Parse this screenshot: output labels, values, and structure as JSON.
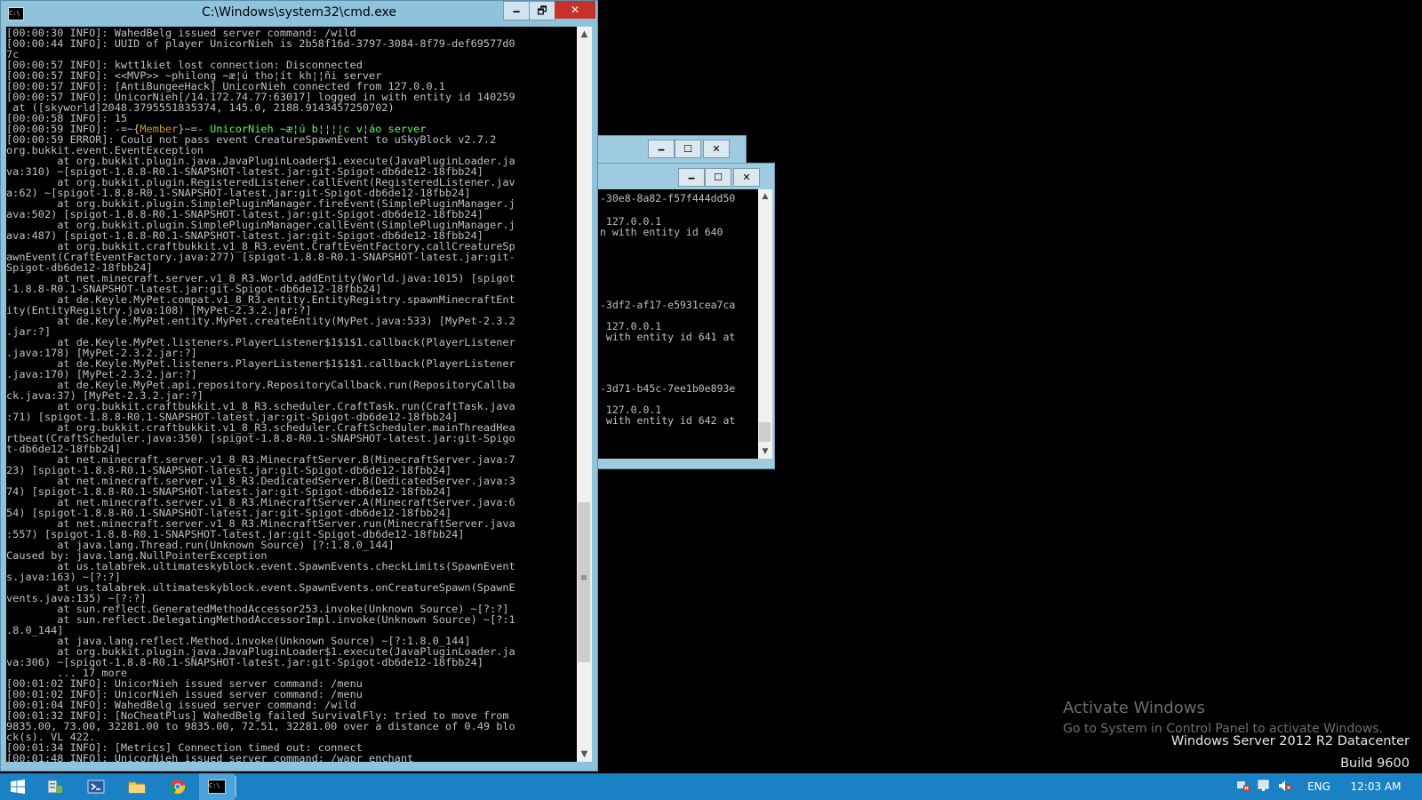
{
  "cmd_window": {
    "title": "C:\\Windows\\system32\\cmd.exe",
    "minimize_label": "🗕",
    "maximize_label": "🗗",
    "close_label": "✕"
  },
  "console_lines": [
    "[00:00:30 INFO]: WahedBelg issued server command: /wild",
    "[00:00:44 INFO]: UUID of player UnicorNieh is 2b58f16d-3797-3084-8f79-def69577d0",
    "7c",
    "[00:00:57 INFO]: kwtt1kiet lost connection: Disconnected",
    "[00:00:57 INFO]: <<MVP>> ~philong ~æ¦ú tho¦ít kh¦¦ñi server",
    "[00:00:57 INFO]: [AntiBungeeHack] UnicorNieh connected from 127.0.0.1",
    "[00:00:57 INFO]: UnicorNieh[/14.172.74.77:63017] logged in with entity id 140259",
    " at ([skyworld]2048.3795551835374, 145.0, 2188.9143457250702)",
    "[00:00:58 INFO]: 15",
    "[00:00:59 INFO]: -=~{Member}~=- UnicorNieh ~æ¦ú b¦¦¦¦c v¦áo server",
    "[00:00:59 ERROR]: Could not pass event CreatureSpawnEvent to uSkyBlock v2.7.2",
    "org.bukkit.event.EventException",
    "        at org.bukkit.plugin.java.JavaPluginLoader$1.execute(JavaPluginLoader.ja",
    "va:310) ~[spigot-1.8.8-R0.1-SNAPSHOT-latest.jar:git-Spigot-db6de12-18fbb24]",
    "        at org.bukkit.plugin.RegisteredListener.callEvent(RegisteredListener.jav",
    "a:62) ~[spigot-1.8.8-R0.1-SNAPSHOT-latest.jar:git-Spigot-db6de12-18fbb24]",
    "        at org.bukkit.plugin.SimplePluginManager.fireEvent(SimplePluginManager.j",
    "ava:502) [spigot-1.8.8-R0.1-SNAPSHOT-latest.jar:git-Spigot-db6de12-18fbb24]",
    "        at org.bukkit.plugin.SimplePluginManager.callEvent(SimplePluginManager.j",
    "ava:487) [spigot-1.8.8-R0.1-SNAPSHOT-latest.jar:git-Spigot-db6de12-18fbb24]",
    "        at org.bukkit.craftbukkit.v1_8_R3.event.CraftEventFactory.callCreatureSp",
    "awnEvent(CraftEventFactory.java:277) [spigot-1.8.8-R0.1-SNAPSHOT-latest.jar:git-",
    "Spigot-db6de12-18fbb24]",
    "        at net.minecraft.server.v1_8_R3.World.addEntity(World.java:1015) [spigot",
    "-1.8.8-R0.1-SNAPSHOT-latest.jar:git-Spigot-db6de12-18fbb24]",
    "        at de.Keyle.MyPet.compat.v1_8_R3.entity.EntityRegistry.spawnMinecraftEnt",
    "ity(EntityRegistry.java:108) [MyPet-2.3.2.jar:?]",
    "        at de.Keyle.MyPet.entity.MyPet.createEntity(MyPet.java:533) [MyPet-2.3.2",
    ".jar:?]",
    "        at de.Keyle.MyPet.listeners.PlayerListener$1$1$1.callback(PlayerListener",
    ".java:178) [MyPet-2.3.2.jar:?]",
    "        at de.Keyle.MyPet.listeners.PlayerListener$1$1$1.callback(PlayerListener",
    ".java:170) [MyPet-2.3.2.jar:?]",
    "        at de.Keyle.MyPet.api.repository.RepositoryCallback.run(RepositoryCallba",
    "ck.java:37) [MyPet-2.3.2.jar:?]",
    "        at org.bukkit.craftbukkit.v1_8_R3.scheduler.CraftTask.run(CraftTask.java",
    ":71) [spigot-1.8.8-R0.1-SNAPSHOT-latest.jar:git-Spigot-db6de12-18fbb24]",
    "        at org.bukkit.craftbukkit.v1_8_R3.scheduler.CraftScheduler.mainThreadHea",
    "rtbeat(CraftScheduler.java:350) [spigot-1.8.8-R0.1-SNAPSHOT-latest.jar:git-Spigo",
    "t-db6de12-18fbb24]",
    "        at net.minecraft.server.v1_8_R3.MinecraftServer.B(MinecraftServer.java:7",
    "23) [spigot-1.8.8-R0.1-SNAPSHOT-latest.jar:git-Spigot-db6de12-18fbb24]",
    "        at net.minecraft.server.v1_8_R3.DedicatedServer.B(DedicatedServer.java:3",
    "74) [spigot-1.8.8-R0.1-SNAPSHOT-latest.jar:git-Spigot-db6de12-18fbb24]",
    "        at net.minecraft.server.v1_8_R3.MinecraftServer.A(MinecraftServer.java:6",
    "54) [spigot-1.8.8-R0.1-SNAPSHOT-latest.jar:git-Spigot-db6de12-18fbb24]",
    "        at net.minecraft.server.v1_8_R3.MinecraftServer.run(MinecraftServer.java",
    ":557) [spigot-1.8.8-R0.1-SNAPSHOT-latest.jar:git-Spigot-db6de12-18fbb24]",
    "        at java.lang.Thread.run(Unknown Source) [?:1.8.0_144]",
    "Caused by: java.lang.NullPointerException",
    "        at us.talabrek.ultimateskyblock.event.SpawnEvents.checkLimits(SpawnEvent",
    "s.java:163) ~[?:?]",
    "        at us.talabrek.ultimateskyblock.event.SpawnEvents.onCreatureSpawn(SpawnE",
    "vents.java:135) ~[?:?]",
    "        at sun.reflect.GeneratedMethodAccessor253.invoke(Unknown Source) ~[?:?]",
    "        at sun.reflect.DelegatingMethodAccessorImpl.invoke(Unknown Source) ~[?:1",
    ".8.0_144]",
    "        at java.lang.reflect.Method.invoke(Unknown Source) ~[?:1.8.0_144]",
    "        at org.bukkit.plugin.java.JavaPluginLoader$1.execute(JavaPluginLoader.ja",
    "va:306) ~[spigot-1.8.8-R0.1-SNAPSHOT-latest.jar:git-Spigot-db6de12-18fbb24]",
    "        ... 17 more",
    "[00:01:02 INFO]: UnicorNieh issued server command: /menu",
    "[00:01:02 INFO]: UnicorNieh issued server command: /menu",
    "[00:01:04 INFO]: WahedBelg issued server command: /wild",
    "[00:01:32 INFO]: [NoCheatPlus] WahedBelg failed SurvivalFly: tried to move from",
    "9835.00, 73.00, 32281.00 to 9835.00, 72.51, 32281.00 over a distance of 0.49 blo",
    "ck(s). VL 422.",
    "[00:01:34 INFO]: [Metrics] Connection timed out: connect",
    "[00:01:48 INFO]: UnicorNieh issued server command: /wapr enchant"
  ],
  "colored_line": {
    "index": 9,
    "prefix": "[00:00:59 INFO]: -=~{",
    "member": "Member",
    "suffix": "}~=- ",
    "rest": "UnicorNieh ~æ¦ú b¦¦¦¦c v¦áo server"
  },
  "bg_window": {
    "lines": [
      "-30e8-8a82-f57f444dd50",
      " 127.0.0.1",
      "n with entity id 640",
      "-3df2-af17-e5931cea7ca",
      " 127.0.0.1",
      " with entity id 641 at",
      "-3d71-b45c-7ee1b0e893e",
      " 127.0.0.1",
      " with entity id 642 at"
    ]
  },
  "watermark": {
    "line1": "Activate Windows",
    "line2": "Go to System in Control Panel to activate Windows.",
    "line3": "Windows Server 2012 R2 Datacenter",
    "line4": "Build 9600"
  },
  "taskbar": {
    "language": "ENG",
    "time": "12:03 AM"
  },
  "colors": {
    "window_frame": "#8fc3dc",
    "taskbar": "#1a81c4",
    "console_text": "#c0c0c0",
    "member_tag": "#c8a000",
    "highlight_text": "#55ff55"
  }
}
